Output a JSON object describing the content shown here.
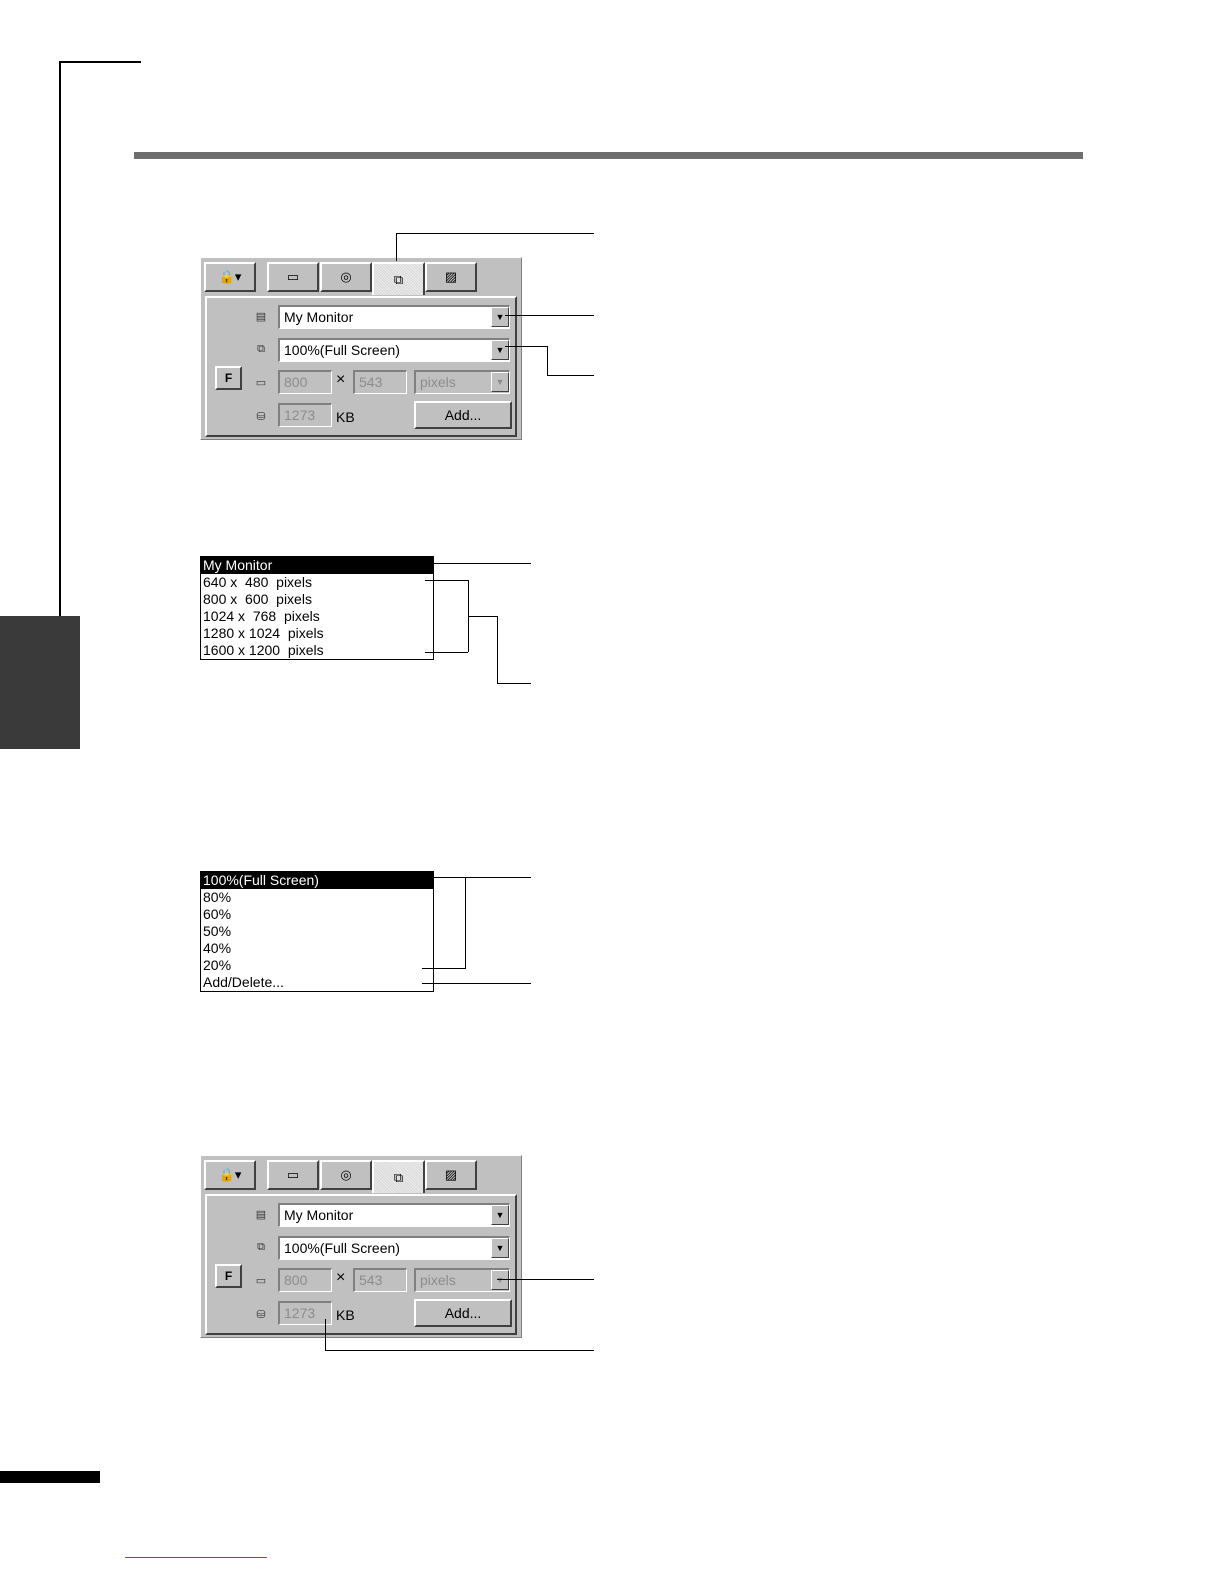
{
  "toolbar": {
    "tabs": [
      {
        "name": "user-icon",
        "glyph": "🔒▾"
      },
      {
        "name": "image-icon",
        "glyph": "▭"
      },
      {
        "name": "color-icon",
        "glyph": "◎"
      },
      {
        "name": "size-icon",
        "glyph": "⧉"
      },
      {
        "name": "picture-icon",
        "glyph": "▨"
      }
    ]
  },
  "panel": {
    "target_value": "My Monitor",
    "scale_value": "100%(Full Screen)",
    "width_value": "800",
    "times": "×",
    "height_value": "543",
    "unit_value": "pixels",
    "size_value": "1273",
    "size_unit": "KB",
    "add_label": "Add...",
    "f_label": "F"
  },
  "target_list": {
    "items": [
      "My Monitor",
      "640 x  480  pixels",
      "800 x  600  pixels",
      "1024 x  768  pixels",
      "1280 x 1024  pixels",
      "1600 x 1200  pixels"
    ],
    "selected_index": 0
  },
  "scale_list": {
    "items": [
      "100%(Full Screen)",
      "80%",
      "60%",
      "50%",
      "40%",
      "20%",
      "Add/Delete..."
    ],
    "selected_index": 0
  },
  "colors": {
    "panel_bg": "#c0c0c0",
    "header_rule": "#6e6e6e",
    "side_tab": "#3a3a3a"
  }
}
